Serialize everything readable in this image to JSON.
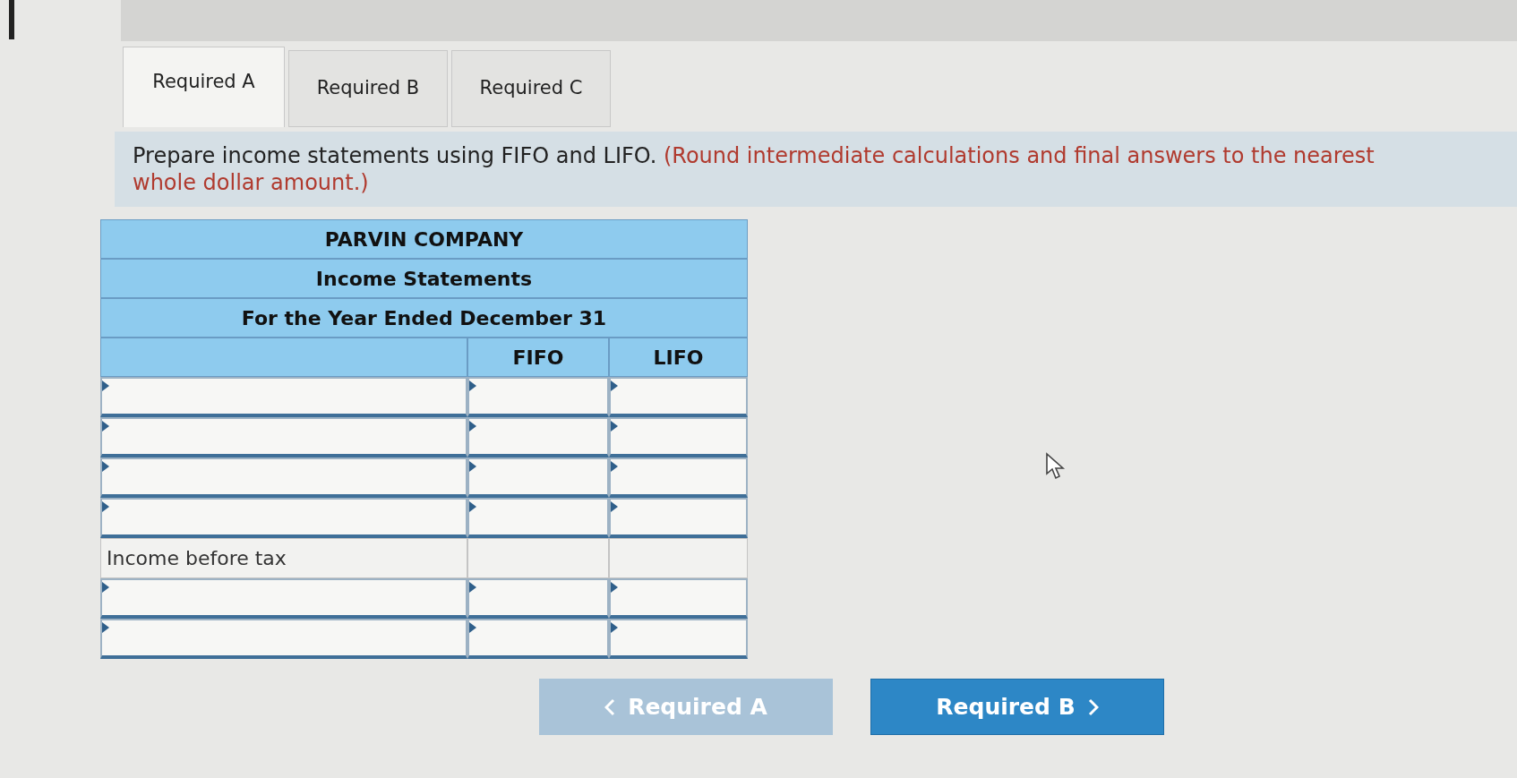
{
  "tabs": [
    {
      "label": "Required A",
      "selected": true
    },
    {
      "label": "Required B",
      "selected": false
    },
    {
      "label": "Required C",
      "selected": false
    }
  ],
  "instruction": {
    "text": "Prepare income statements using FIFO and LIFO.",
    "note": "(Round intermediate calculations and final answers to the nearest whole dollar amount.)"
  },
  "table": {
    "title_lines": [
      "PARVIN COMPANY",
      "Income Statements",
      "For the Year Ended December 31"
    ],
    "columns": [
      "FIFO",
      "LIFO"
    ],
    "rows": [
      {
        "kind": "input"
      },
      {
        "kind": "input"
      },
      {
        "kind": "input"
      },
      {
        "kind": "input"
      },
      {
        "kind": "label",
        "label": "Income before tax"
      },
      {
        "kind": "input"
      },
      {
        "kind": "input"
      }
    ]
  },
  "nav": [
    {
      "label": "Required A",
      "kind": "prev",
      "disabled": true
    },
    {
      "label": "Required B",
      "kind": "next",
      "disabled": false
    }
  ]
}
